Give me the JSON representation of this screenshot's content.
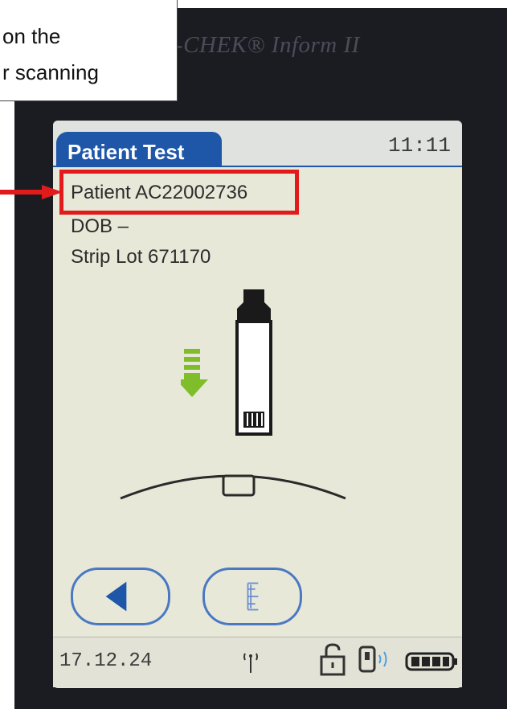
{
  "callout": {
    "line1": "on the",
    "line2": "r scanning"
  },
  "device": {
    "brand": "-CHEK® Inform II"
  },
  "screen": {
    "title": "Patient Test",
    "time": "11:11",
    "patient": "Patient AC22002736",
    "dob": "DOB –",
    "strip_lot": "Strip Lot 671170"
  },
  "buttons": {
    "back_icon": "back-arrow-icon",
    "menu_icon": "menu-list-icon"
  },
  "status": {
    "date": "17.12.24",
    "icons": [
      "wireless-icon",
      "unlock-icon",
      "device-docked-icon",
      "battery-icon"
    ]
  },
  "colors": {
    "title_bg": "#1e56a8",
    "highlight": "#e11b1b",
    "arrow_green": "#7fbd2b"
  }
}
